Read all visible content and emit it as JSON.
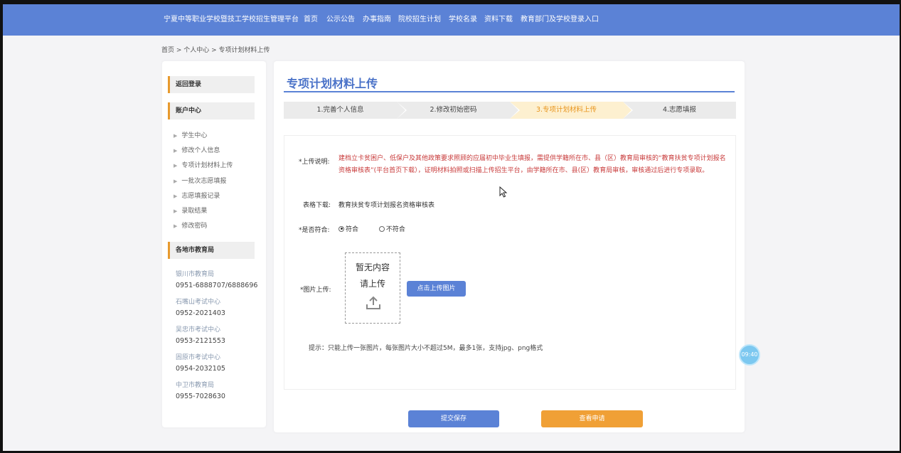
{
  "nav": {
    "site_title": "宁夏中等职业学校暨技工学校招生管理平台",
    "items": [
      "首页",
      "公示公告",
      "办事指南",
      "院校招生计划",
      "学校名录",
      "资料下载",
      "教育部门及学校登录入口"
    ]
  },
  "breadcrumb": "首页 > 个人中心 > 专项计划材料上传",
  "sidebar": {
    "back_login": "返回登录",
    "account_center": "账户中心",
    "links": [
      "学生中心",
      "修改个人信息",
      "专项计划材料上传",
      "一批次志愿填报",
      "志愿填报记录",
      "录取结果",
      "修改密码"
    ],
    "offices_title": "各地市教育局",
    "offices": [
      {
        "name": "银川市教育局",
        "phone": "0951-6888707/6888696"
      },
      {
        "name": "石嘴山考试中心",
        "phone": "0952-2021403"
      },
      {
        "name": "吴忠市考试中心",
        "phone": "0953-2121553"
      },
      {
        "name": "固原市考试中心",
        "phone": "0954-2032105"
      },
      {
        "name": "中卫市教育局",
        "phone": "0955-7028630"
      }
    ]
  },
  "main": {
    "title": "专项计划材料上传",
    "steps": [
      "1.完善个人信息",
      "2.修改初始密码",
      "3.专项计划材料上传",
      "4.志愿填报"
    ],
    "active_step": 3,
    "upload_desc_label": "*上传说明:",
    "upload_desc": "建档立卡贫困户、低保户及其他政策要求照顾的应届初中毕业生填报，需提供学籍所在市、县（区）教育局审核的“教育扶贫专项计划报名资格审核表”(平台首页下载），证明材料拍照或扫描上传招生平台，由学籍所在市、县(区）教育局审核，审核通过后进行专项录取。",
    "form_download_label": "表格下载:",
    "form_download_link": "教育扶贫专项计划报名资格审核表",
    "eligible_label": "*是否符合:",
    "option_yes": "符合",
    "option_no": "不符合",
    "selected_option": "符合",
    "image_upload_label": "*图片上传:",
    "upload_placeholder_1": "暂无内容",
    "upload_placeholder_2": "请上传",
    "upload_button": "点击上传图片",
    "hint": "提示：只能上传一张图片，每张图片大小不超过5M，最多1张，支持jpg、png格式",
    "save_button": "提交保存",
    "view_button": "查看申请"
  },
  "floating_clock": "09:40",
  "colors": {
    "nav": "#5b82d6",
    "accent": "#e89a2e",
    "warning_text": "#c83a3a",
    "active_step_bg": "#fdf0d0"
  }
}
